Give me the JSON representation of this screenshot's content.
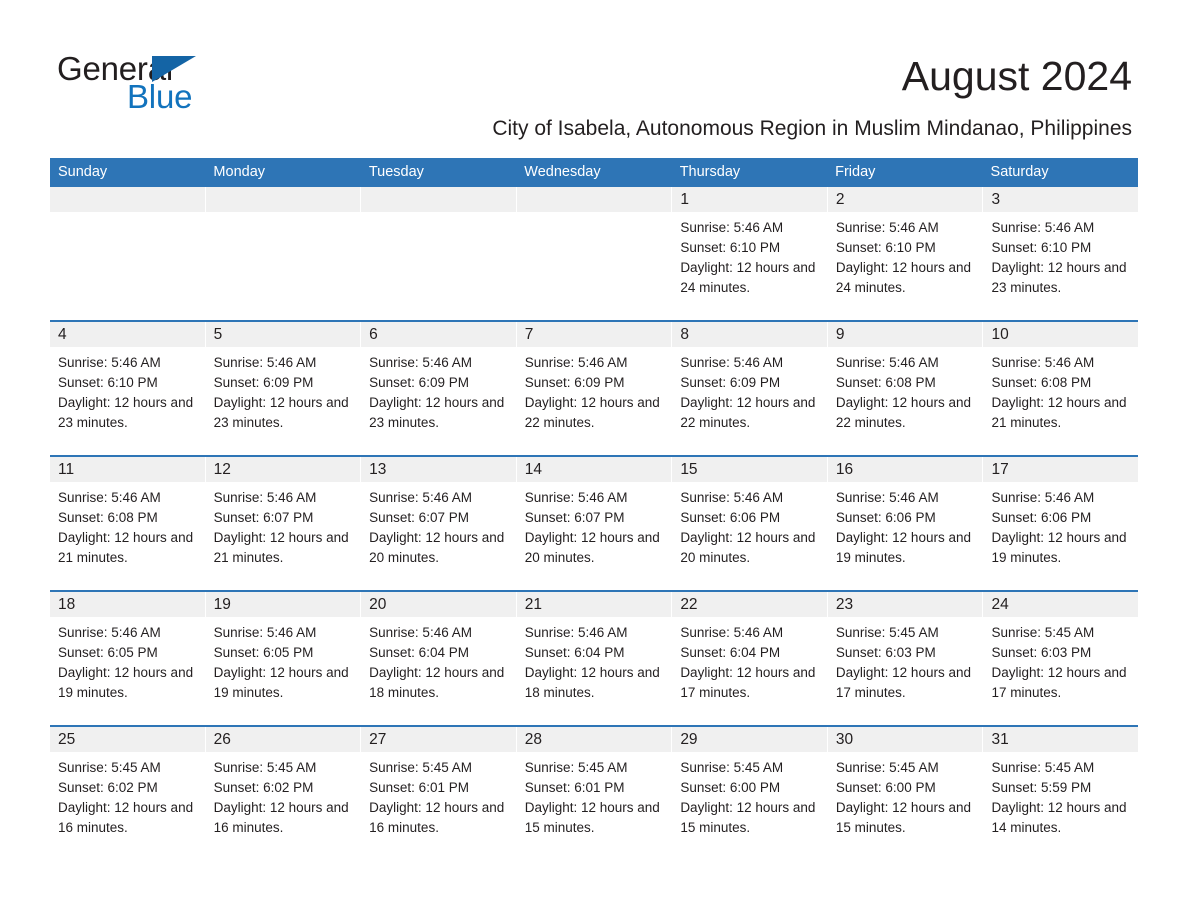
{
  "brand": {
    "name_part1": "General",
    "name_part2": "Blue",
    "triangle_icon": "triangle-icon",
    "accent_color": "#1273bd"
  },
  "header": {
    "title": "August 2024",
    "subtitle": "City of Isabela, Autonomous Region in Muslim Mindanao, Philippines"
  },
  "calendar": {
    "header_bg": "#2e75b6",
    "weekday_headers": [
      "Sunday",
      "Monday",
      "Tuesday",
      "Wednesday",
      "Thursday",
      "Friday",
      "Saturday"
    ],
    "weeks": [
      [
        {
          "day": "",
          "empty": true
        },
        {
          "day": "",
          "empty": true
        },
        {
          "day": "",
          "empty": true
        },
        {
          "day": "",
          "empty": true
        },
        {
          "day": "1",
          "sunrise": "Sunrise: 5:46 AM",
          "sunset": "Sunset: 6:10 PM",
          "daylight": "Daylight: 12 hours and 24 minutes."
        },
        {
          "day": "2",
          "sunrise": "Sunrise: 5:46 AM",
          "sunset": "Sunset: 6:10 PM",
          "daylight": "Daylight: 12 hours and 24 minutes."
        },
        {
          "day": "3",
          "sunrise": "Sunrise: 5:46 AM",
          "sunset": "Sunset: 6:10 PM",
          "daylight": "Daylight: 12 hours and 23 minutes."
        }
      ],
      [
        {
          "day": "4",
          "sunrise": "Sunrise: 5:46 AM",
          "sunset": "Sunset: 6:10 PM",
          "daylight": "Daylight: 12 hours and 23 minutes."
        },
        {
          "day": "5",
          "sunrise": "Sunrise: 5:46 AM",
          "sunset": "Sunset: 6:09 PM",
          "daylight": "Daylight: 12 hours and 23 minutes."
        },
        {
          "day": "6",
          "sunrise": "Sunrise: 5:46 AM",
          "sunset": "Sunset: 6:09 PM",
          "daylight": "Daylight: 12 hours and 23 minutes."
        },
        {
          "day": "7",
          "sunrise": "Sunrise: 5:46 AM",
          "sunset": "Sunset: 6:09 PM",
          "daylight": "Daylight: 12 hours and 22 minutes."
        },
        {
          "day": "8",
          "sunrise": "Sunrise: 5:46 AM",
          "sunset": "Sunset: 6:09 PM",
          "daylight": "Daylight: 12 hours and 22 minutes."
        },
        {
          "day": "9",
          "sunrise": "Sunrise: 5:46 AM",
          "sunset": "Sunset: 6:08 PM",
          "daylight": "Daylight: 12 hours and 22 minutes."
        },
        {
          "day": "10",
          "sunrise": "Sunrise: 5:46 AM",
          "sunset": "Sunset: 6:08 PM",
          "daylight": "Daylight: 12 hours and 21 minutes."
        }
      ],
      [
        {
          "day": "11",
          "sunrise": "Sunrise: 5:46 AM",
          "sunset": "Sunset: 6:08 PM",
          "daylight": "Daylight: 12 hours and 21 minutes."
        },
        {
          "day": "12",
          "sunrise": "Sunrise: 5:46 AM",
          "sunset": "Sunset: 6:07 PM",
          "daylight": "Daylight: 12 hours and 21 minutes."
        },
        {
          "day": "13",
          "sunrise": "Sunrise: 5:46 AM",
          "sunset": "Sunset: 6:07 PM",
          "daylight": "Daylight: 12 hours and 20 minutes."
        },
        {
          "day": "14",
          "sunrise": "Sunrise: 5:46 AM",
          "sunset": "Sunset: 6:07 PM",
          "daylight": "Daylight: 12 hours and 20 minutes."
        },
        {
          "day": "15",
          "sunrise": "Sunrise: 5:46 AM",
          "sunset": "Sunset: 6:06 PM",
          "daylight": "Daylight: 12 hours and 20 minutes."
        },
        {
          "day": "16",
          "sunrise": "Sunrise: 5:46 AM",
          "sunset": "Sunset: 6:06 PM",
          "daylight": "Daylight: 12 hours and 19 minutes."
        },
        {
          "day": "17",
          "sunrise": "Sunrise: 5:46 AM",
          "sunset": "Sunset: 6:06 PM",
          "daylight": "Daylight: 12 hours and 19 minutes."
        }
      ],
      [
        {
          "day": "18",
          "sunrise": "Sunrise: 5:46 AM",
          "sunset": "Sunset: 6:05 PM",
          "daylight": "Daylight: 12 hours and 19 minutes."
        },
        {
          "day": "19",
          "sunrise": "Sunrise: 5:46 AM",
          "sunset": "Sunset: 6:05 PM",
          "daylight": "Daylight: 12 hours and 19 minutes."
        },
        {
          "day": "20",
          "sunrise": "Sunrise: 5:46 AM",
          "sunset": "Sunset: 6:04 PM",
          "daylight": "Daylight: 12 hours and 18 minutes."
        },
        {
          "day": "21",
          "sunrise": "Sunrise: 5:46 AM",
          "sunset": "Sunset: 6:04 PM",
          "daylight": "Daylight: 12 hours and 18 minutes."
        },
        {
          "day": "22",
          "sunrise": "Sunrise: 5:46 AM",
          "sunset": "Sunset: 6:04 PM",
          "daylight": "Daylight: 12 hours and 17 minutes."
        },
        {
          "day": "23",
          "sunrise": "Sunrise: 5:45 AM",
          "sunset": "Sunset: 6:03 PM",
          "daylight": "Daylight: 12 hours and 17 minutes."
        },
        {
          "day": "24",
          "sunrise": "Sunrise: 5:45 AM",
          "sunset": "Sunset: 6:03 PM",
          "daylight": "Daylight: 12 hours and 17 minutes."
        }
      ],
      [
        {
          "day": "25",
          "sunrise": "Sunrise: 5:45 AM",
          "sunset": "Sunset: 6:02 PM",
          "daylight": "Daylight: 12 hours and 16 minutes."
        },
        {
          "day": "26",
          "sunrise": "Sunrise: 5:45 AM",
          "sunset": "Sunset: 6:02 PM",
          "daylight": "Daylight: 12 hours and 16 minutes."
        },
        {
          "day": "27",
          "sunrise": "Sunrise: 5:45 AM",
          "sunset": "Sunset: 6:01 PM",
          "daylight": "Daylight: 12 hours and 16 minutes."
        },
        {
          "day": "28",
          "sunrise": "Sunrise: 5:45 AM",
          "sunset": "Sunset: 6:01 PM",
          "daylight": "Daylight: 12 hours and 15 minutes."
        },
        {
          "day": "29",
          "sunrise": "Sunrise: 5:45 AM",
          "sunset": "Sunset: 6:00 PM",
          "daylight": "Daylight: 12 hours and 15 minutes."
        },
        {
          "day": "30",
          "sunrise": "Sunrise: 5:45 AM",
          "sunset": "Sunset: 6:00 PM",
          "daylight": "Daylight: 12 hours and 15 minutes."
        },
        {
          "day": "31",
          "sunrise": "Sunrise: 5:45 AM",
          "sunset": "Sunset: 5:59 PM",
          "daylight": "Daylight: 12 hours and 14 minutes."
        }
      ]
    ]
  }
}
